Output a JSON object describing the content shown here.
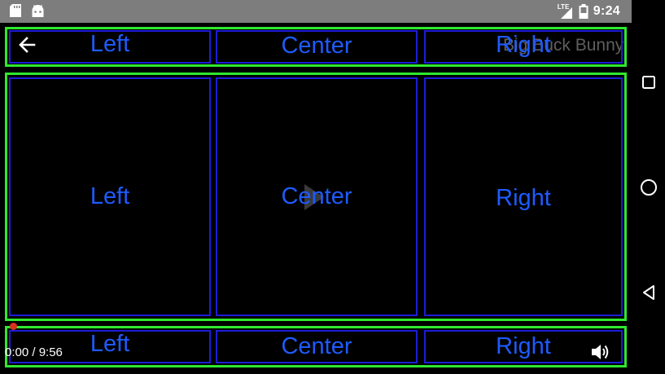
{
  "status_bar": {
    "time": "9:24",
    "network": "LTE",
    "left_icons": [
      "sd-card-icon",
      "android-icon"
    ],
    "right_icons": [
      "lte-signal-icon",
      "battery-icon"
    ]
  },
  "player": {
    "title": "Big Buck Bunny",
    "back_icon": "arrow-left-icon",
    "play_icon": "play-icon",
    "volume_icon": "volume-icon",
    "time_display": "0:00 / 9:56",
    "accent_color": "#d8321e"
  },
  "layout_debug": {
    "top_row": {
      "left": "Left",
      "center": "Center",
      "right": "Right"
    },
    "middle_row": {
      "left": "Left",
      "center": "Center",
      "right": "Right"
    },
    "bottom_row": {
      "left": "Left",
      "center": "Center",
      "right": "Right"
    },
    "row_border_color": "#2ee82e",
    "cell_border_color": "#1d1dd6",
    "label_color": "#1e5bff"
  },
  "nav_bar": {
    "buttons": [
      "recents-square-icon",
      "home-circle-icon",
      "back-triangle-icon"
    ]
  }
}
